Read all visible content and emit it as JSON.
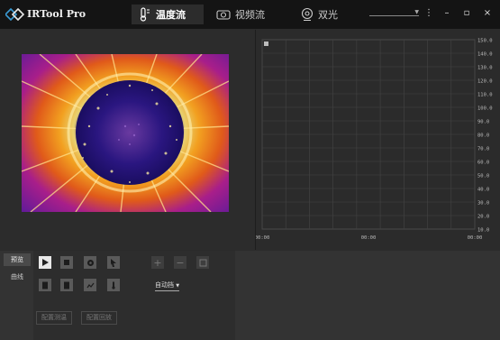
{
  "app": {
    "title": "IRTool Pro"
  },
  "tabs": [
    {
      "label": "温度流",
      "icon": "thermometer-icon",
      "active": true
    },
    {
      "label": "视频流",
      "icon": "camera-icon",
      "active": false
    },
    {
      "label": "双光",
      "icon": "webcam-icon",
      "active": false
    }
  ],
  "window_controls": {
    "menu": "⋮",
    "minimize": "–",
    "maximize": "▫",
    "close": "×"
  },
  "chart_data": {
    "type": "line",
    "series": [],
    "x_ticks": [
      "00:00",
      "00:00",
      "00:00"
    ],
    "y_ticks": [
      "150.0",
      "140.0",
      "130.0",
      "120.0",
      "110.0",
      "100.0",
      "90.0",
      "80.0",
      "70.0",
      "60.0",
      "50.0",
      "40.0",
      "30.0",
      "20.0",
      "10.0"
    ],
    "ylim": [
      10,
      150
    ],
    "grid": true,
    "legend": "top-left"
  },
  "side_tabs": [
    "预览",
    "曲线"
  ],
  "toolbar": {
    "row1": [
      "play-button",
      "stop-button",
      "settings-button",
      "cursor-button"
    ],
    "row1_right": [
      "zoom-in-button",
      "zoom-out-button",
      "fit-button"
    ],
    "row2": [
      "save-image-button",
      "save-video-button",
      "chart-button",
      "temperature-button"
    ],
    "mode_label": "自动挡",
    "buttons": [
      "配置测温",
      "配置回放"
    ]
  },
  "colors": {
    "accent": "#3a7bd5",
    "titlebar": "#141414",
    "panel": "#2c2c2c"
  }
}
